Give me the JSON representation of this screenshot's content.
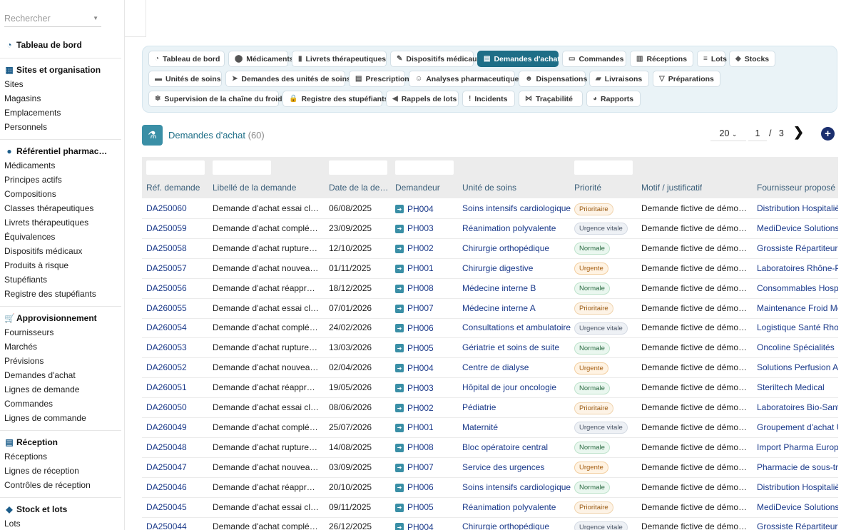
{
  "search": {
    "placeholder": "Rechercher"
  },
  "sidebar": {
    "dashboard": {
      "label": "Tableau de bord",
      "icon": "gauge-icon"
    },
    "sections": [
      {
        "title": "Sites et organisation",
        "icon": "building-icon",
        "items": [
          "Sites",
          "Magasins",
          "Emplacements",
          "Personnels"
        ]
      },
      {
        "title": "Référentiel pharmac…",
        "icon": "pills-icon",
        "items": [
          "Médicaments",
          "Principes actifs",
          "Compositions",
          "Classes thérapeutiques",
          "Livrets thérapeutiques",
          "Équivalences",
          "Dispositifs médicaux",
          "Produits à risque",
          "Stupéfiants",
          "Registre des stupéfiants"
        ]
      },
      {
        "title": "Approvisionnement",
        "icon": "cart-icon",
        "items": [
          "Fournisseurs",
          "Marchés",
          "Prévisions",
          "Demandes d'achat",
          "Lignes de demande",
          "Commandes",
          "Lignes de commande"
        ]
      },
      {
        "title": "Réception",
        "icon": "dolly-icon",
        "items": [
          "Réceptions",
          "Lignes de réception",
          "Contrôles de réception"
        ]
      },
      {
        "title": "Stock et lots",
        "icon": "boxes-icon",
        "items": [
          "Lots"
        ]
      }
    ]
  },
  "tabs": [
    {
      "label": "Tableau de bord",
      "icon": "gauge-icon"
    },
    {
      "label": "Médicaments",
      "icon": "pills-icon"
    },
    {
      "label": "Livrets thérapeutiques",
      "icon": "book-icon"
    },
    {
      "label": "Dispositifs médicaux",
      "icon": "syringe-icon"
    },
    {
      "label": "Demandes d'achat",
      "icon": "file-icon",
      "active": true
    },
    {
      "label": "Commandes",
      "icon": "cart-icon"
    },
    {
      "label": "Réceptions",
      "icon": "dolly-icon"
    },
    {
      "label": "Lots",
      "icon": "layers-icon"
    },
    {
      "label": "Stocks",
      "icon": "boxes-icon"
    },
    {
      "label": "Unités de soins",
      "icon": "bed-icon"
    },
    {
      "label": "Demandes des unités de soins",
      "icon": "send-icon"
    },
    {
      "label": "Prescriptions",
      "icon": "prescription-icon"
    },
    {
      "label": "Analyses pharmaceutiques",
      "icon": "user-check-icon"
    },
    {
      "label": "Dispensations",
      "icon": "user-hand-icon"
    },
    {
      "label": "Livraisons",
      "icon": "truck-icon"
    },
    {
      "label": "Préparations",
      "icon": "mortar-icon"
    },
    {
      "label": "Supervision de la chaîne du froid",
      "icon": "snowflake-icon"
    },
    {
      "label": "Registre des stupéfiants",
      "icon": "lock-icon"
    },
    {
      "label": "Rappels de lots",
      "icon": "megaphone-icon"
    },
    {
      "label": "Incidents",
      "icon": "alert-icon"
    },
    {
      "label": "Traçabilité",
      "icon": "network-icon"
    },
    {
      "label": "Rapports",
      "icon": "chart-pie-icon"
    }
  ],
  "page": {
    "title": "Demandes d'achat",
    "count": "(60)"
  },
  "pager": {
    "page_size": "20",
    "current_page": "1",
    "separator": "/",
    "total_pages": "3",
    "next": "❯",
    "add": "+"
  },
  "table": {
    "columns": [
      "Réf. demande",
      "Libellé de la demande",
      "Date de la de…",
      "Demandeur",
      "Unité de soins",
      "Priorité",
      "Motif / justificatif",
      "Fournisseur proposé"
    ],
    "rows": [
      {
        "ref": "DA250060",
        "libelle": "Demande d'achat essai clini…",
        "date": "06/08/2025",
        "demandeur": "PH004",
        "unite": "Soins intensifs cardiologiques",
        "priorite": "Prioritaire",
        "motif": "Demande fictive de démons…",
        "fournisseur": "Distribution Hospitalière"
      },
      {
        "ref": "DA250059",
        "libelle": "Demande d'achat complém…",
        "date": "23/09/2025",
        "demandeur": "PH003",
        "unite": "Réanimation polyvalente",
        "priorite": "Urgence vitale",
        "motif": "Demande fictive de démons…",
        "fournisseur": "MediDevice Solutions"
      },
      {
        "ref": "DA250058",
        "libelle": "Demande d'achat rupture fo…",
        "date": "12/10/2025",
        "demandeur": "PH002",
        "unite": "Chirurgie orthopédique",
        "priorite": "Normale",
        "motif": "Demande fictive de démons…",
        "fournisseur": "Grossiste Répartiteur A"
      },
      {
        "ref": "DA250057",
        "libelle": "Demande d'achat nouveau …",
        "date": "01/11/2025",
        "demandeur": "PH001",
        "unite": "Chirurgie digestive",
        "priorite": "Urgente",
        "motif": "Demande fictive de démons…",
        "fournisseur": "Laboratoires Rhône-Ph"
      },
      {
        "ref": "DA250056",
        "libelle": "Demande d'achat réapprovi…",
        "date": "18/12/2025",
        "demandeur": "PH008",
        "unite": "Médecine interne B",
        "priorite": "Normale",
        "motif": "Demande fictive de démons…",
        "fournisseur": "Consommables Hospita"
      },
      {
        "ref": "DA260055",
        "libelle": "Demande d'achat essai clini…",
        "date": "07/01/2026",
        "demandeur": "PH007",
        "unite": "Médecine interne A",
        "priorite": "Prioritaire",
        "motif": "Demande fictive de démons…",
        "fournisseur": "Maintenance Froid Méd"
      },
      {
        "ref": "DA260054",
        "libelle": "Demande d'achat complém…",
        "date": "24/02/2026",
        "demandeur": "PH006",
        "unite": "Consultations et ambulatoire",
        "priorite": "Urgence vitale",
        "motif": "Demande fictive de démons…",
        "fournisseur": "Logistique Santé Rhod"
      },
      {
        "ref": "DA260053",
        "libelle": "Demande d'achat rupture fo…",
        "date": "13/03/2026",
        "demandeur": "PH005",
        "unite": "Gériatrie et soins de suite",
        "priorite": "Normale",
        "motif": "Demande fictive de démons…",
        "fournisseur": "Oncoline Spécialités"
      },
      {
        "ref": "DA260052",
        "libelle": "Demande d'achat nouveau …",
        "date": "02/04/2026",
        "demandeur": "PH004",
        "unite": "Centre de dialyse",
        "priorite": "Urgente",
        "motif": "Demande fictive de démons…",
        "fournisseur": "Solutions Perfusion Atla"
      },
      {
        "ref": "DA260051",
        "libelle": "Demande d'achat réapprovi…",
        "date": "19/05/2026",
        "demandeur": "PH003",
        "unite": "Hôpital de jour oncologie",
        "priorite": "Normale",
        "motif": "Demande fictive de démons…",
        "fournisseur": "Steriltech Medical"
      },
      {
        "ref": "DA260050",
        "libelle": "Demande d'achat essai clini…",
        "date": "08/06/2026",
        "demandeur": "PH002",
        "unite": "Pédiatrie",
        "priorite": "Prioritaire",
        "motif": "Demande fictive de démons…",
        "fournisseur": "Laboratoires Bio-Santé"
      },
      {
        "ref": "DA260049",
        "libelle": "Demande d'achat complém…",
        "date": "25/07/2026",
        "demandeur": "PH001",
        "unite": "Maternité",
        "priorite": "Urgence vitale",
        "motif": "Demande fictive de démons…",
        "fournisseur": "Groupement d'achat Ur"
      },
      {
        "ref": "DA250048",
        "libelle": "Demande d'achat rupture fo…",
        "date": "14/08/2025",
        "demandeur": "PH008",
        "unite": "Bloc opératoire central",
        "priorite": "Normale",
        "motif": "Demande fictive de démons…",
        "fournisseur": "Import Pharma Europe"
      },
      {
        "ref": "DA250047",
        "libelle": "Demande d'achat nouveau …",
        "date": "03/09/2025",
        "demandeur": "PH007",
        "unite": "Service des urgences",
        "priorite": "Urgente",
        "motif": "Demande fictive de démons…",
        "fournisseur": "Pharmacie de sous-trai"
      },
      {
        "ref": "DA250046",
        "libelle": "Demande d'achat réapprovi…",
        "date": "20/10/2025",
        "demandeur": "PH006",
        "unite": "Soins intensifs cardiologiques",
        "priorite": "Normale",
        "motif": "Demande fictive de démons…",
        "fournisseur": "Distribution Hospitalière"
      },
      {
        "ref": "DA250045",
        "libelle": "Demande d'achat essai clini…",
        "date": "09/11/2025",
        "demandeur": "PH005",
        "unite": "Réanimation polyvalente",
        "priorite": "Prioritaire",
        "motif": "Demande fictive de démons…",
        "fournisseur": "MediDevice Solutions"
      },
      {
        "ref": "DA250044",
        "libelle": "Demande d'achat complém…",
        "date": "26/12/2025",
        "demandeur": "PH004",
        "unite": "Chirurgie orthopédique",
        "priorite": "Urgence vitale",
        "motif": "Demande fictive de démons…",
        "fournisseur": "Grossiste Répartiteur A"
      }
    ]
  },
  "colors": {
    "accent": "#1e6e87",
    "link": "#1b3a8a",
    "header_text": "#3b5f7a",
    "add_button": "#1b2f6e"
  }
}
